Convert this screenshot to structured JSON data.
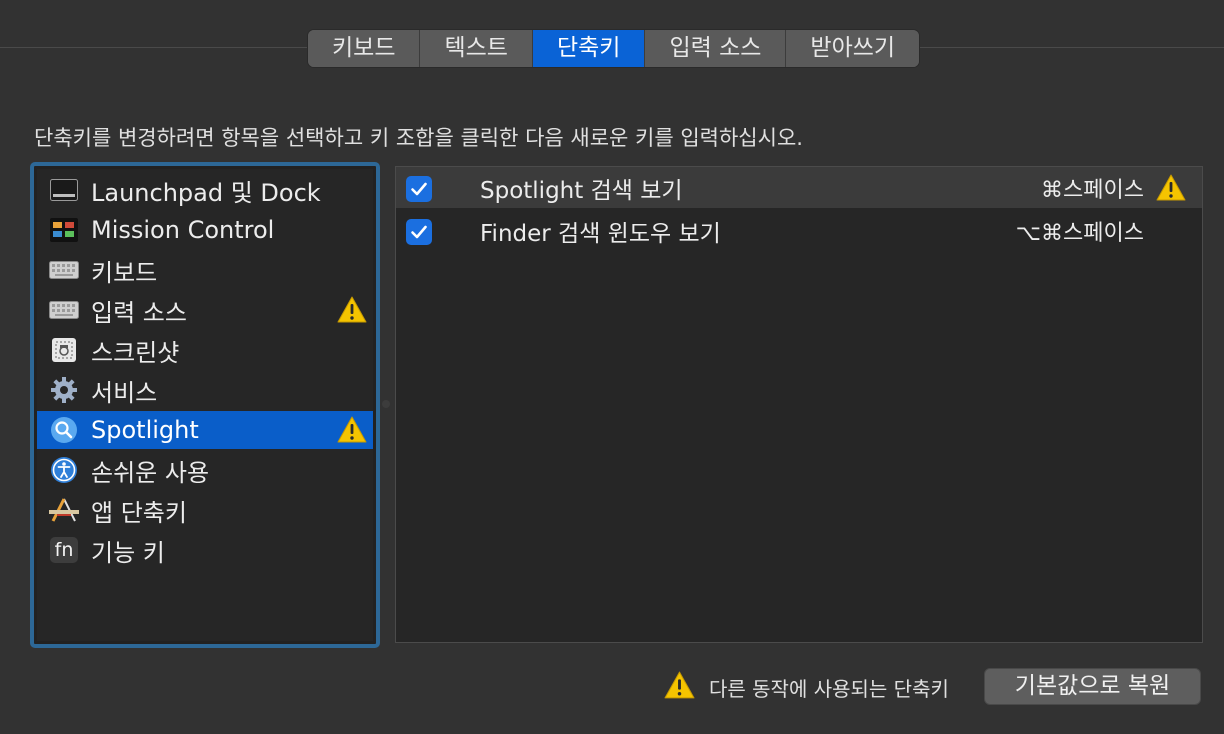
{
  "tabs": [
    {
      "label": "키보드",
      "active": false
    },
    {
      "label": "텍스트",
      "active": false
    },
    {
      "label": "단축키",
      "active": true
    },
    {
      "label": "입력 소스",
      "active": false
    },
    {
      "label": "받아쓰기",
      "active": false
    }
  ],
  "instruction": "단축키를 변경하려면 항목을 선택하고 키 조합을 클릭한 다음 새로운 키를 입력하십시오.",
  "categories": [
    {
      "label": "Launchpad 및 Dock",
      "icon": "launchpad-dock-icon",
      "warning": false,
      "selected": false
    },
    {
      "label": "Mission Control",
      "icon": "mission-control-icon",
      "warning": false,
      "selected": false
    },
    {
      "label": "키보드",
      "icon": "keyboard-icon",
      "warning": false,
      "selected": false
    },
    {
      "label": "입력 소스",
      "icon": "keyboard-icon",
      "warning": true,
      "selected": false
    },
    {
      "label": "스크린샷",
      "icon": "screenshot-icon",
      "warning": false,
      "selected": false
    },
    {
      "label": "서비스",
      "icon": "gear-icon",
      "warning": false,
      "selected": false
    },
    {
      "label": "Spotlight",
      "icon": "spotlight-search-icon",
      "warning": true,
      "selected": true
    },
    {
      "label": "손쉬운 사용",
      "icon": "accessibility-icon",
      "warning": false,
      "selected": false
    },
    {
      "label": "앱 단축키",
      "icon": "app-shortcuts-icon",
      "warning": false,
      "selected": false
    },
    {
      "label": "기능 키",
      "icon": "fn-key-icon",
      "icon_text": "fn",
      "warning": false,
      "selected": false
    }
  ],
  "shortcuts": [
    {
      "label": "Spotlight 검색 보기",
      "key": "⌘스페이스",
      "checked": true,
      "warning": true
    },
    {
      "label": "Finder 검색 윈도우 보기",
      "key": "⌥⌘스페이스",
      "checked": true,
      "warning": false
    }
  ],
  "legend": {
    "text": "다른 동작에 사용되는 단축키"
  },
  "restore_button": {
    "label": "기본값으로 복원"
  },
  "colors": {
    "accent": "#0a63d6",
    "selection": "#0a5ec9",
    "warning": "#f5c400",
    "checkbox": "#1b6fe0"
  }
}
